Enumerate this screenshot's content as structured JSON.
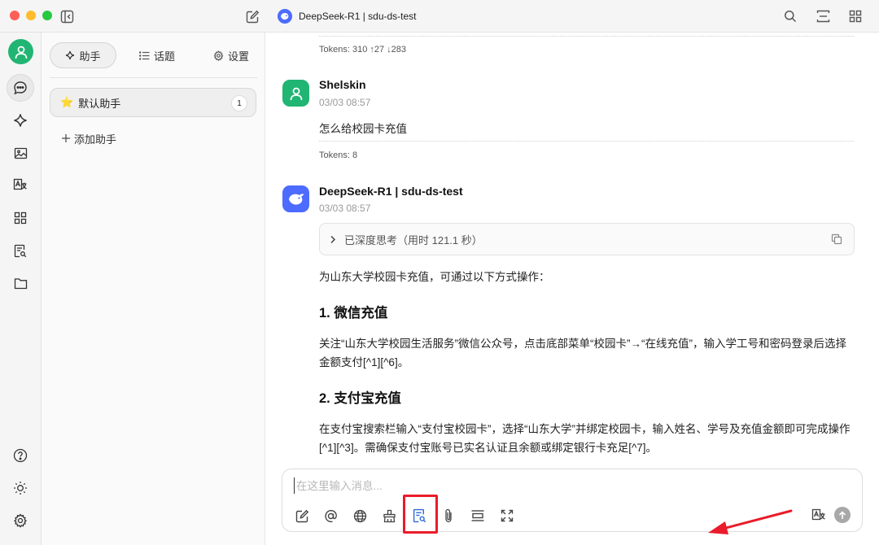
{
  "window": {
    "title": "DeepSeek-R1 | sdu-ds-test"
  },
  "sidebar": {
    "tabs": [
      {
        "label": "助手",
        "icon": "sparkle-icon"
      },
      {
        "label": "话题",
        "icon": "list-icon"
      },
      {
        "label": "设置",
        "icon": "gear-icon"
      }
    ],
    "assistant": {
      "emoji": "⭐️",
      "name": "默认助手",
      "count": "1"
    },
    "add_label": "添加助手"
  },
  "messages": {
    "prev_tokens": "Tokens: 310 ↑27 ↓283",
    "user": {
      "name": "Shelskin",
      "time": "03/03 08:57",
      "text": "怎么给校园卡充值",
      "tokens": "Tokens: 8"
    },
    "bot": {
      "name": "DeepSeek-R1 | sdu-ds-test",
      "time": "03/03 08:57",
      "thinking": "已深度思考（用时 121.1 秒）",
      "intro": "为山东大学校园卡充值，可通过以下方式操作：",
      "h1": "1. 微信充值",
      "p1": "关注“山东大学校园生活服务”微信公众号，点击底部菜单“校园卡”→“在线充值”，输入学工号和密码登录后选择金额支付[^1][^6]。",
      "h2": "2. 支付宝充值",
      "p2": "在支付宝搜索栏输入“支付宝校园卡”，选择“山东大学”并绑定校园卡，输入姓名、学号及充值金额即可完成操作[^1][^3]。需确保支付宝账号已实名认证且余额或绑定银行卡充足[^7]。"
    }
  },
  "input": {
    "placeholder": "在这里输入消息...",
    "value": ""
  },
  "colors": {
    "accent_green": "#21b573",
    "deepseek_blue": "#4d6bfe",
    "highlight_red": "#ea1b2a"
  }
}
